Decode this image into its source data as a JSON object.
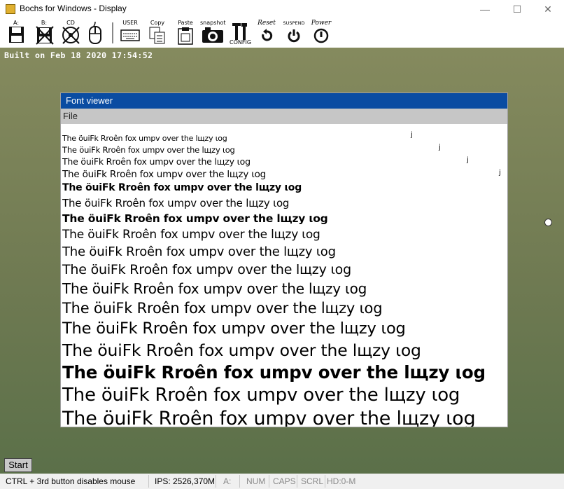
{
  "window": {
    "title": "Bochs for Windows - Display",
    "minimize": "—",
    "maximize": "☐",
    "close": "✕"
  },
  "toolbar": {
    "floppy_a": "A:",
    "floppy_b": "B:",
    "cdrom": "CD",
    "user": "USER",
    "copy": "Copy",
    "paste": "Paste",
    "snapshot": "snapshot",
    "config": "CONFIG",
    "reset": "Reset",
    "suspend": "SUSPEND",
    "power": "Power"
  },
  "display": {
    "built": "Built on Feb 18 2020 17:54:52",
    "start": "Start",
    "font_viewer": {
      "title": "Font viewer",
      "menu_file": "File",
      "sample_text": "The öuiFk Rroên fox  umpv over the lщzy ιog",
      "stray_glyph": "j"
    }
  },
  "statusbar": {
    "hint": "CTRL + 3rd button disables mouse",
    "ips": "IPS: 2526,370M",
    "drive": "A:",
    "num": "NUM",
    "caps": "CAPS",
    "scrl": "SCRL",
    "hd": "HD:0-M"
  }
}
